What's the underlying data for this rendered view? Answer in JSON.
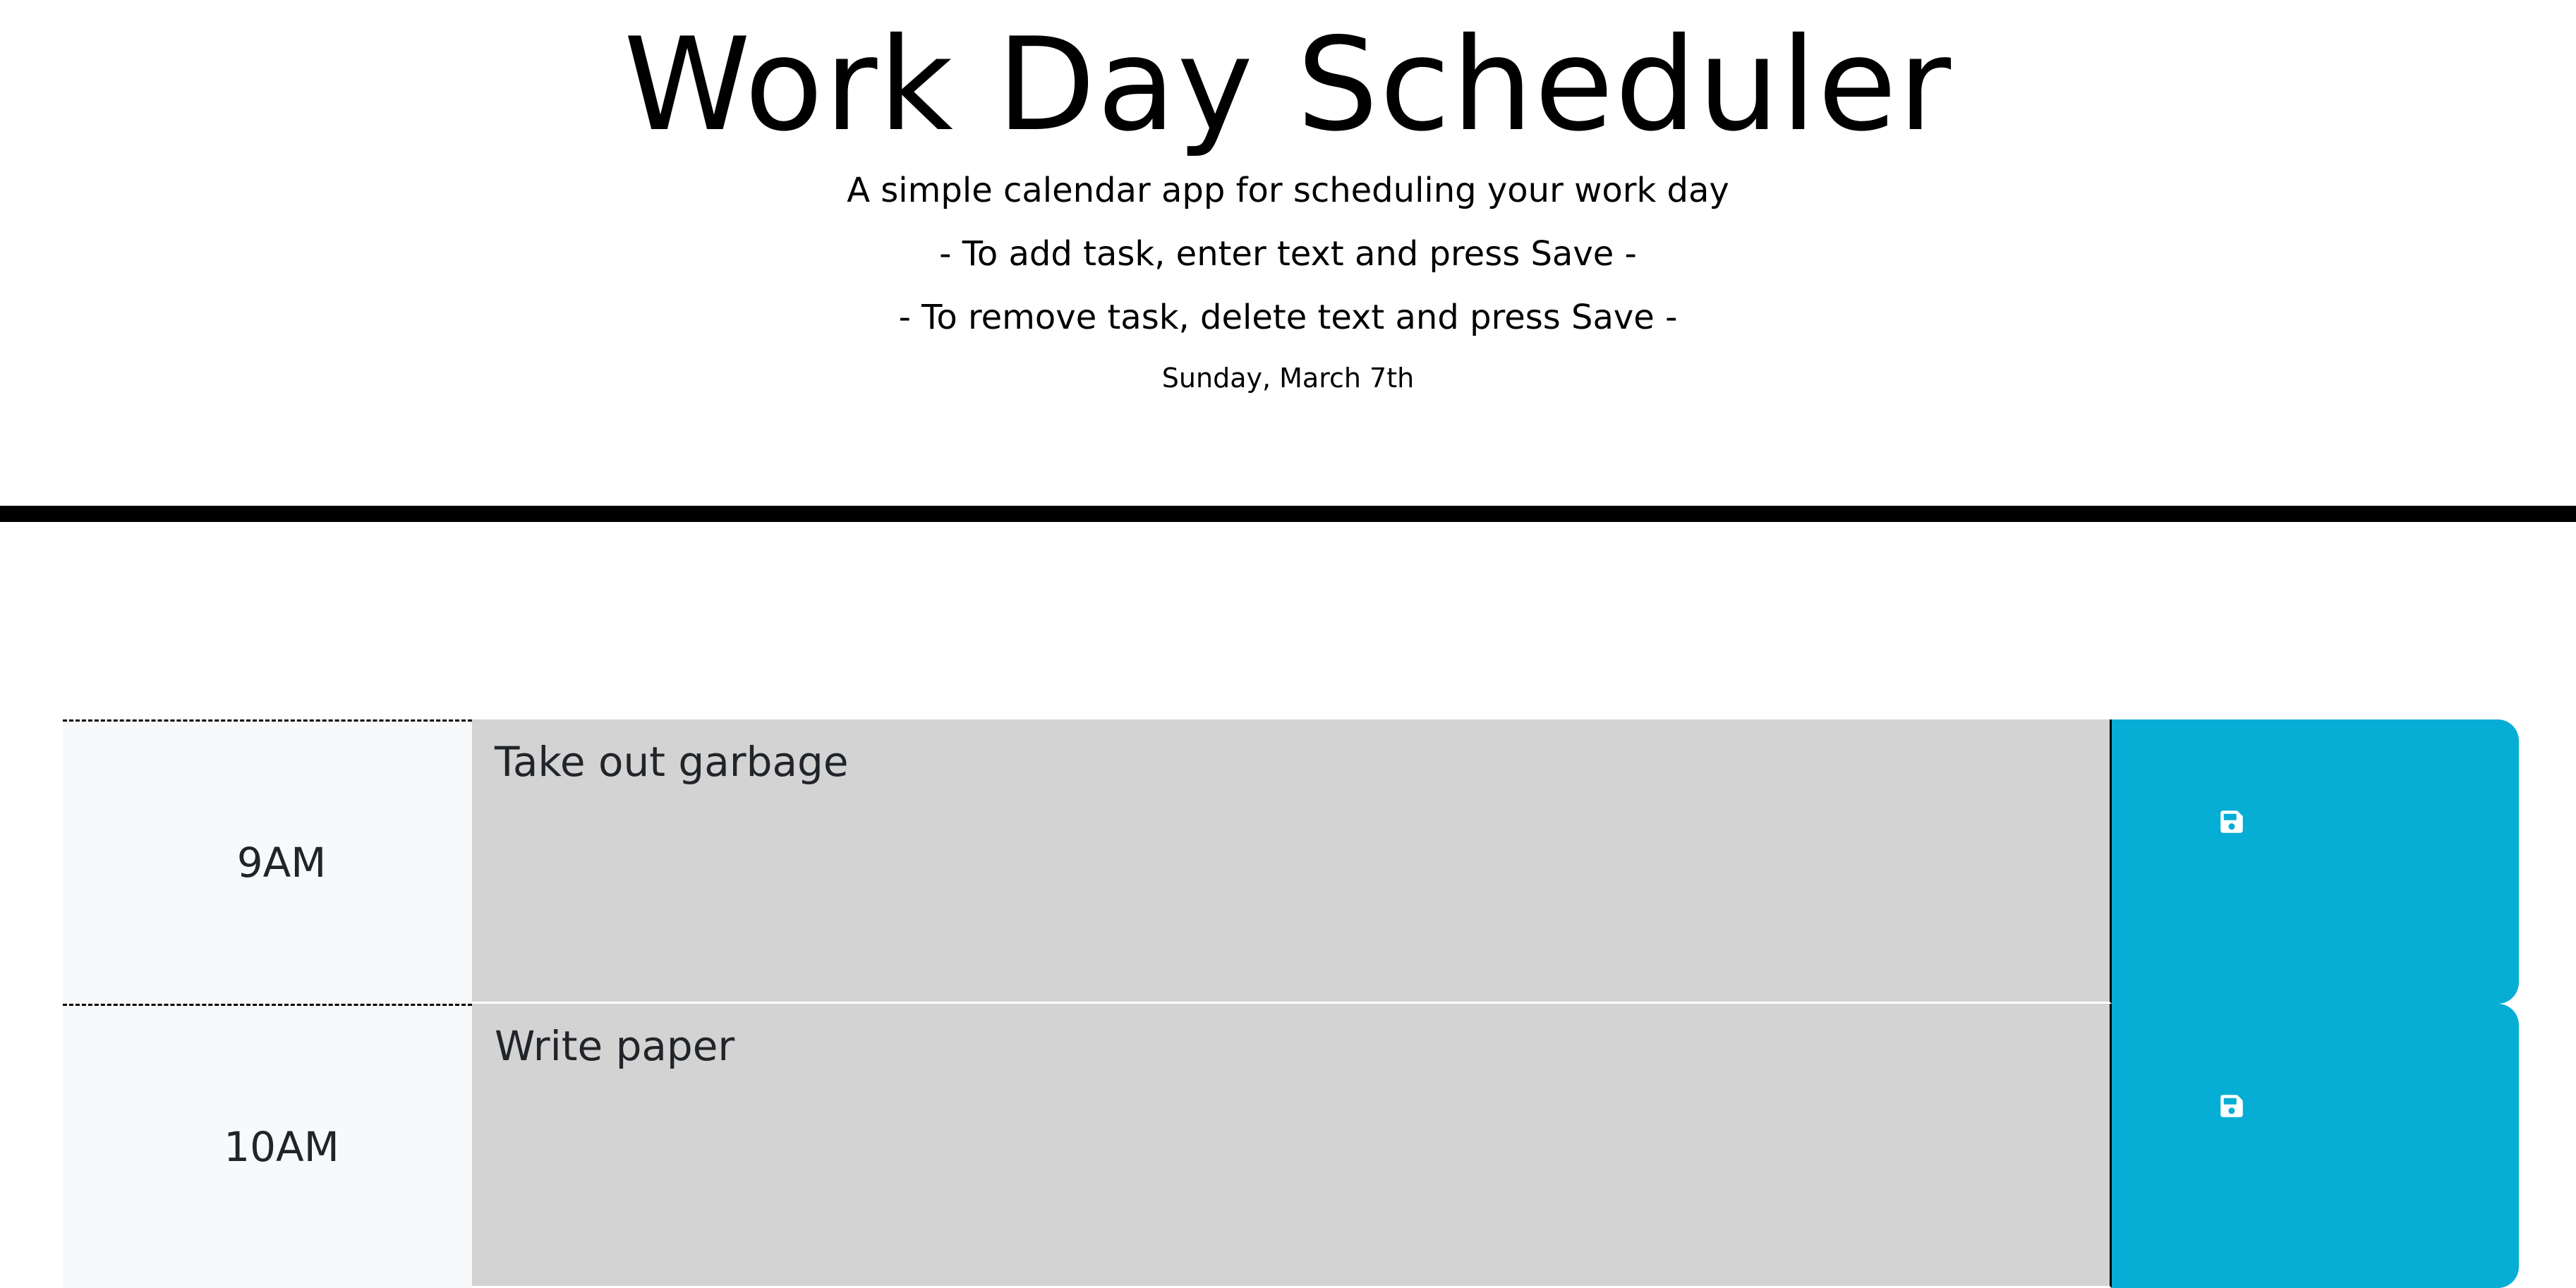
{
  "header": {
    "title": "Work Day Scheduler",
    "subtitle": "A simple calendar app for scheduling your work day",
    "instruction_add": "- To add task, enter text and press Save -",
    "instruction_remove": "- To remove task, delete text and press Save -",
    "current_day": "Sunday, March 7th"
  },
  "colors": {
    "save_button": "#06aed5",
    "task_past": "#d3d3d3",
    "hour_bg": "#f8f9fa",
    "divider": "#000000"
  },
  "rows": [
    {
      "hour": "9AM",
      "task": "Take out garbage",
      "save_icon": "floppy-disk-icon"
    },
    {
      "hour": "10AM",
      "task": "Write paper",
      "save_icon": "floppy-disk-icon"
    }
  ]
}
